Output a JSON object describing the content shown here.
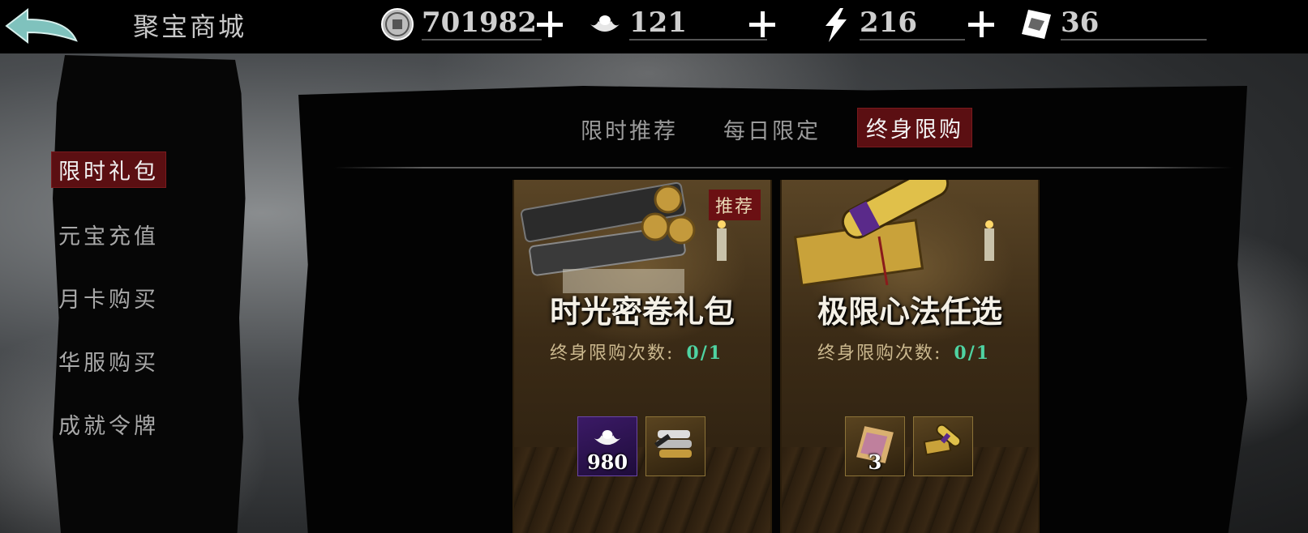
{
  "header": {
    "title": "聚宝商城",
    "resources": [
      {
        "icon": "coin-icon",
        "value": "701982"
      },
      {
        "icon": "ingot-icon",
        "value": "121"
      },
      {
        "icon": "lightning-icon",
        "value": "216"
      },
      {
        "icon": "ticket-icon",
        "value": "36"
      }
    ]
  },
  "sidebar": {
    "items": [
      {
        "label": "限时礼包",
        "active": true
      },
      {
        "label": "元宝充值",
        "active": false
      },
      {
        "label": "月卡购买",
        "active": false
      },
      {
        "label": "华服购买",
        "active": false
      },
      {
        "label": "成就令牌",
        "active": false
      }
    ]
  },
  "tabs": [
    {
      "label": "限时推荐",
      "active": false
    },
    {
      "label": "每日限定",
      "active": false
    },
    {
      "label": "终身限购",
      "active": true
    }
  ],
  "cards": [
    {
      "name": "时光密卷礼包",
      "badge": "推荐",
      "limit_label": "终身限购次数:",
      "limit_count": "0/1",
      "items": [
        {
          "icon": "ingot-icon",
          "qty": "980",
          "rarity": "purple"
        },
        {
          "icon": "scroll-bundle-icon",
          "qty": "",
          "rarity": "gold"
        }
      ]
    },
    {
      "name": "极限心法任选",
      "badge": "",
      "limit_label": "终身限购次数:",
      "limit_count": "0/1",
      "items": [
        {
          "icon": "ticket-icon",
          "qty": "3",
          "rarity": "gold"
        },
        {
          "icon": "scroll-box-icon",
          "qty": "",
          "rarity": "gold"
        }
      ]
    }
  ],
  "colors": {
    "active_tab_bg": "#5b0f12",
    "limit_count": "#4fd3a2",
    "purple_slot": "#3b1a66"
  }
}
